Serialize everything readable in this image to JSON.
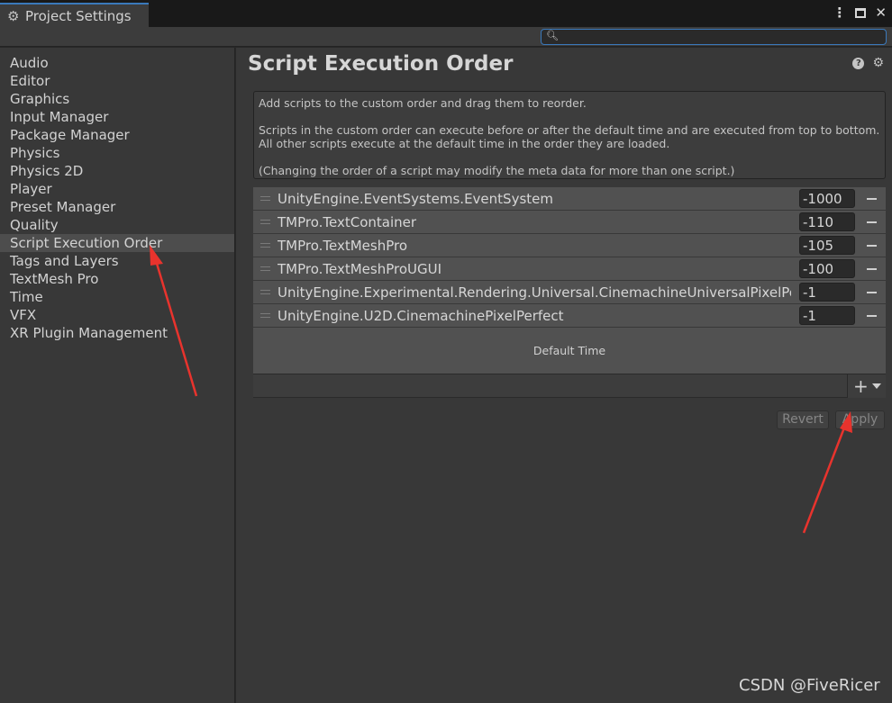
{
  "window": {
    "tab_title": "Project Settings",
    "tab_icon": "gear-icon"
  },
  "search": {
    "value": "",
    "placeholder": ""
  },
  "sidebar": {
    "items": [
      {
        "label": "Audio"
      },
      {
        "label": "Editor"
      },
      {
        "label": "Graphics"
      },
      {
        "label": "Input Manager"
      },
      {
        "label": "Package Manager"
      },
      {
        "label": "Physics"
      },
      {
        "label": "Physics 2D"
      },
      {
        "label": "Player"
      },
      {
        "label": "Preset Manager"
      },
      {
        "label": "Quality"
      },
      {
        "label": "Script Execution Order"
      },
      {
        "label": "Tags and Layers"
      },
      {
        "label": "TextMesh Pro"
      },
      {
        "label": "Time"
      },
      {
        "label": "VFX"
      },
      {
        "label": "XR Plugin Management"
      }
    ],
    "selected": "Script Execution Order"
  },
  "main": {
    "title": "Script Execution Order",
    "help_text": [
      "Add scripts to the custom order and drag them to reorder.",
      "Scripts in the custom order can execute before or after the default time and are executed from top to bottom. All other scripts execute at the default time in the order they are loaded.",
      "(Changing the order of a script may modify the meta data for more than one script.)"
    ],
    "scripts": [
      {
        "name": "UnityEngine.EventSystems.EventSystem",
        "order": "-1000"
      },
      {
        "name": "TMPro.TextContainer",
        "order": "-110"
      },
      {
        "name": "TMPro.TextMeshPro",
        "order": "-105"
      },
      {
        "name": "TMPro.TextMeshProUGUI",
        "order": "-100"
      },
      {
        "name": "UnityEngine.Experimental.Rendering.Universal.CinemachineUniversalPixelPerfect",
        "order": "-1"
      },
      {
        "name": "UnityEngine.U2D.CinemachinePixelPerfect",
        "order": "-1"
      }
    ],
    "default_time_label": "Default Time",
    "add_label": "+",
    "revert_label": "Revert",
    "apply_label": "Apply"
  },
  "colors": {
    "accent": "#3a79bb",
    "annotation_arrow": "#e8332d"
  },
  "watermark": "CSDN @FiveRicer"
}
